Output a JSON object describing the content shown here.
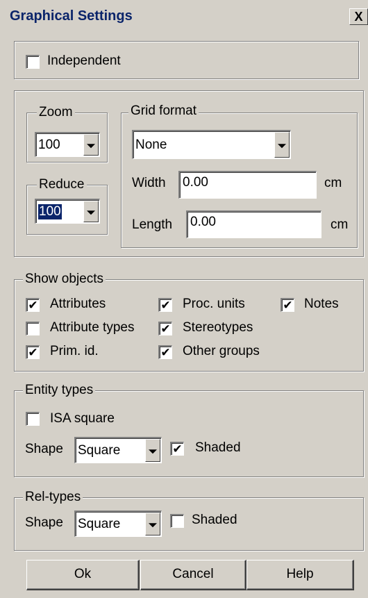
{
  "window": {
    "title": "Graphical Settings",
    "close_label": "X"
  },
  "independent": {
    "label": "Independent",
    "checked": false
  },
  "zoom": {
    "legend": "Zoom",
    "value": "100"
  },
  "reduce": {
    "legend": "Reduce",
    "value": "100"
  },
  "grid": {
    "legend": "Grid format",
    "format_value": "None",
    "width_label": "Width",
    "width_value": "0.00",
    "width_unit": "cm",
    "length_label": "Length",
    "length_value": "0.00",
    "length_unit": "cm"
  },
  "show_objects": {
    "legend": "Show objects",
    "items": [
      {
        "label": "Attributes",
        "checked": true,
        "mark": "✔"
      },
      {
        "label": "Proc. units",
        "checked": true,
        "mark": "✔"
      },
      {
        "label": "Notes",
        "checked": true,
        "mark": "✔"
      },
      {
        "label": "Attribute types",
        "checked": false,
        "mark": ""
      },
      {
        "label": "Stereotypes",
        "checked": true,
        "mark": "✔"
      },
      {
        "label": "Prim. id.",
        "checked": true,
        "mark": "✔"
      },
      {
        "label": "Other groups",
        "checked": true,
        "mark": "✔"
      }
    ]
  },
  "entity_types": {
    "legend": "Entity types",
    "isa_label": "ISA square",
    "isa_checked": false,
    "isa_mark": "",
    "shape_label": "Shape",
    "shape_value": "Square",
    "shaded_label": "Shaded",
    "shaded_checked": true,
    "shaded_mark": "✔"
  },
  "rel_types": {
    "legend": "Rel-types",
    "shape_label": "Shape",
    "shape_value": "Square",
    "shaded_label": "Shaded",
    "shaded_checked": false,
    "shaded_mark": ""
  },
  "buttons": {
    "ok": "Ok",
    "cancel": "Cancel",
    "help": "Help"
  }
}
